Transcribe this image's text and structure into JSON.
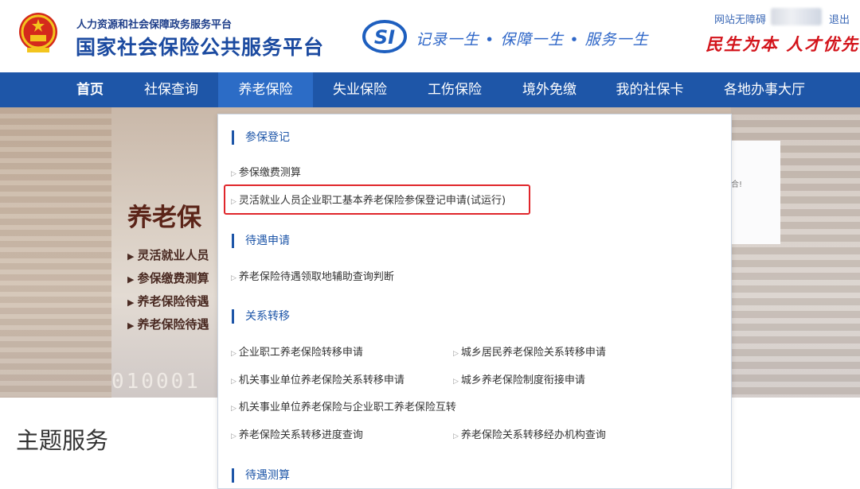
{
  "header": {
    "org_subtitle": "人力资源和社会保障政务服务平台",
    "org_title": "国家社会保险公共服务平台",
    "si_logo_text": "SI",
    "slogan": "记录一生 • 保障一生 • 服务一生",
    "accessibility_link": "网站无障碍",
    "logout": "退出",
    "motto": "民生为本 人才优先"
  },
  "nav": {
    "items": [
      {
        "label": "首页"
      },
      {
        "label": "社保查询"
      },
      {
        "label": "养老保险"
      },
      {
        "label": "失业保险"
      },
      {
        "label": "工伤保险"
      },
      {
        "label": "境外免缴"
      },
      {
        "label": "我的社保卡"
      },
      {
        "label": "各地办事大厅"
      }
    ],
    "active": "养老保险",
    "bg_color": "#1e56a8"
  },
  "banner": {
    "title": "养老保",
    "items": [
      "灵活就业人员",
      "参保缴费测算",
      "养老保险待遇",
      "养老保险待遇"
    ],
    "digits": "010001",
    "card_text": "合!"
  },
  "dropdown": {
    "sections": [
      {
        "heading": "参保登记",
        "links": [
          "参保缴费测算",
          "灵活就业人员企业职工基本养老保险参保登记申请(试运行)"
        ]
      },
      {
        "heading": "待遇申请",
        "links": [
          "养老保险待遇领取地辅助查询判断"
        ]
      },
      {
        "heading": "关系转移",
        "links": [
          "企业职工养老保险转移申请",
          "城乡居民养老保险关系转移申请",
          "机关事业单位养老保险关系转移申请",
          "城乡养老保险制度衔接申请",
          "机关事业单位养老保险与企业职工养老保险互转",
          "养老保险关系转移进度查询",
          "养老保险关系转移经办机构查询"
        ]
      },
      {
        "heading": "待遇测算",
        "links": []
      }
    ],
    "highlight_color": "#e0262b"
  },
  "main": {
    "theme_title": "主题服务"
  }
}
